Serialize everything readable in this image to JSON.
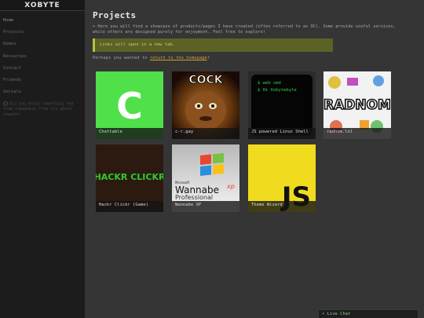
{
  "brand": "XOBYTE",
  "nav": [
    "Home",
    "Projects",
    "Demos",
    "Resources",
    "Contact",
    "Friends",
    "Socials"
  ],
  "side_note": "Did you enjoy something red from somewhere from its whole chapter.",
  "page": {
    "title": "Projects",
    "intro": "> Here you will find a showcase of products/pages I have created (often referred to as OC). Some provide useful services, while others are designed purely for enjoyment. Feel free to explore!",
    "notice": "Links will open in a new tab.",
    "perhaps_prefix": "Perhaps you wanted to ",
    "perhaps_link": "return to the homepage",
    "perhaps_suffix": "?"
  },
  "projects": [
    {
      "caption": "Chattable",
      "thumb_text": "C",
      "bg": "#4fe04a"
    },
    {
      "caption": "c-r.gay",
      "thumb_text": "COCK",
      "bg": "#5a3a10"
    },
    {
      "caption": "JS powered Linux Shell",
      "thumb_text": "$ web cmd\n$ Hi Xobytebyte",
      "bg": "#0a0a0a"
    },
    {
      "caption": "radnom.lol",
      "thumb_text": "RADNOM",
      "bg": "#f0f0f0"
    },
    {
      "caption": "Hackr Clickr (Game)",
      "thumb_text": "HACKR CLICKR",
      "bg": "#2a1a10"
    },
    {
      "caption": "Wannabe XP",
      "thumb_text": "Wannabe",
      "thumb_sub": "Professional",
      "thumb_brand": "Microsoft",
      "thumb_xp": "xp",
      "bg": "#d8d8d8"
    },
    {
      "caption": "Theme Wizard",
      "thumb_text": "JS",
      "bg": "#f0db1e"
    }
  ],
  "livechat": "• Live Chat"
}
